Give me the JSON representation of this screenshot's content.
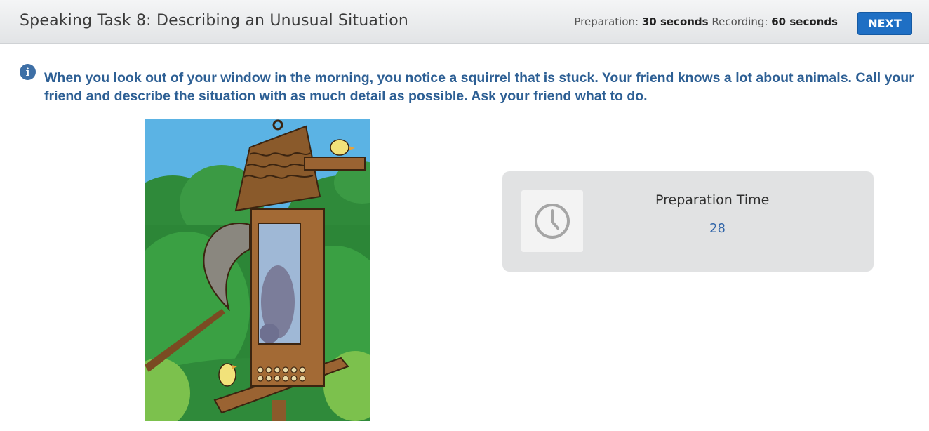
{
  "header": {
    "title": "Speaking Task 8: Describing an Unusual Situation",
    "preparation_label": "Preparation:",
    "preparation_value": "30 seconds",
    "recording_label": "Recording:",
    "recording_value": "60 seconds",
    "next_label": "NEXT"
  },
  "task": {
    "info_icon": "info-icon",
    "prompt": "When you look out of your window in the morning, you notice a squirrel that is stuck. Your friend knows a lot about animals. Call your friend and describe the situation with as much detail as possible. Ask your friend what to do."
  },
  "preparation_panel": {
    "icon": "clock-icon",
    "label": "Preparation Time",
    "seconds_left": "28"
  },
  "colors": {
    "accent": "#1f6fc4",
    "prompt_text": "#2d5f94",
    "panel_bg": "#e1e2e3"
  }
}
